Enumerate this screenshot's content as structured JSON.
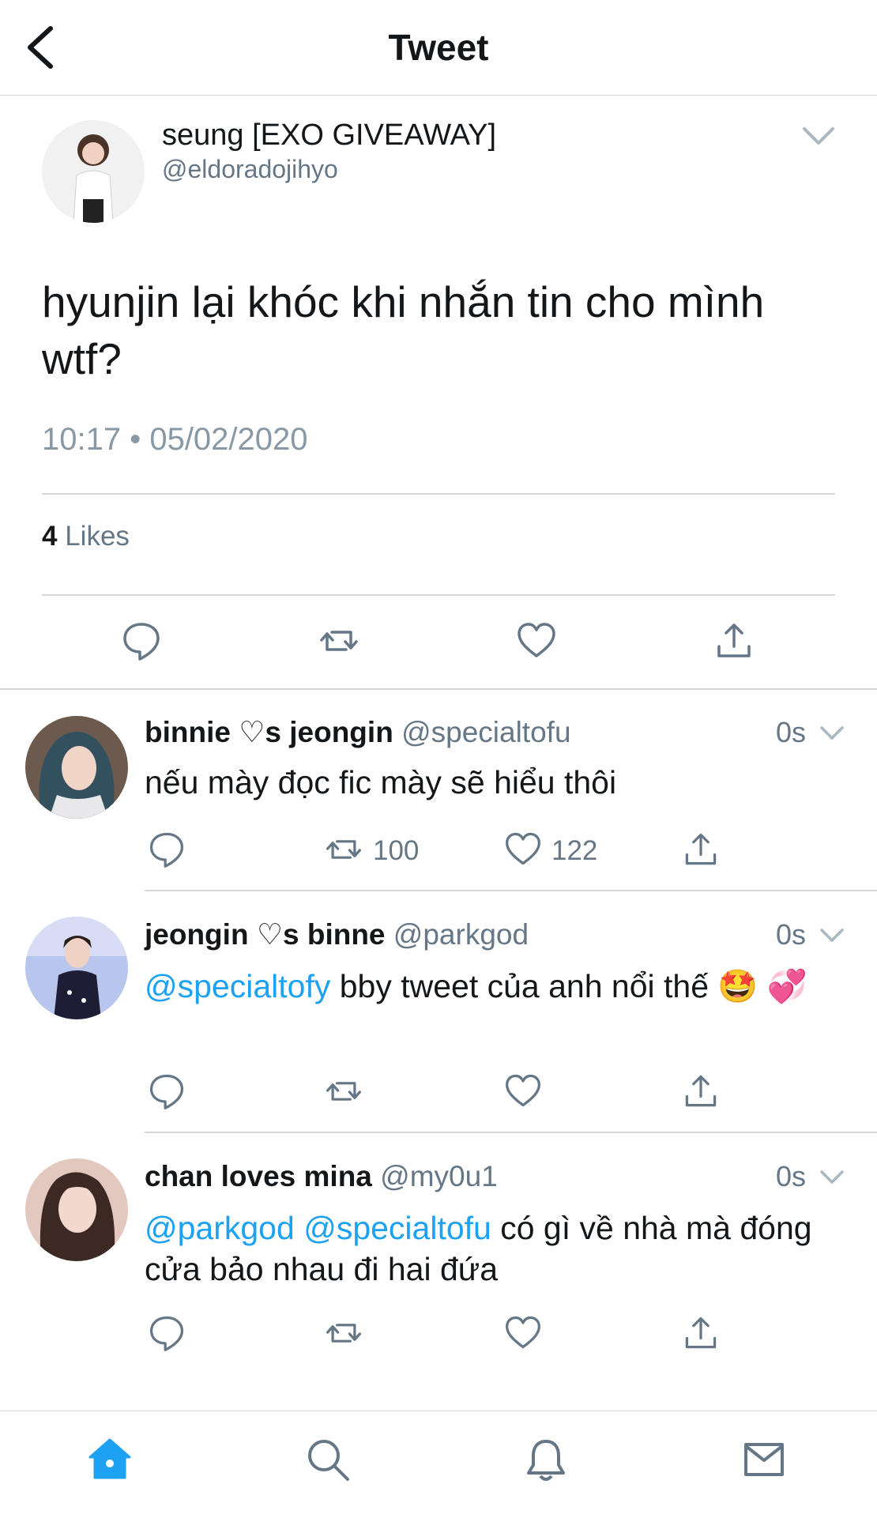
{
  "header": {
    "title": "Tweet",
    "back_icon": "back-arrow-icon"
  },
  "main_tweet": {
    "display_name": "seung [EXO GIVEAWAY]",
    "handle": "@eldoradojihyo",
    "text": "hyunjin lại khóc khi nhắn tin cho mình wtf?",
    "timestamp": "10:17 • 05/02/2020",
    "likes_count": "4",
    "likes_label": "Likes"
  },
  "replies": [
    {
      "display_name": "binnie ♡s jeongin",
      "handle": "@specialtofu",
      "time": "0s",
      "text": "nếu mày đọc fic mày sẽ hiểu thôi",
      "retweets": "100",
      "likes": "122"
    },
    {
      "display_name": "jeongin ♡s binne",
      "handle": "@parkgod",
      "time": "0s",
      "mention": "@specialtofy",
      "text": " bby tweet của anh nổi thế 🤩 💞",
      "retweets": "",
      "likes": ""
    },
    {
      "display_name": "chan loves mina",
      "handle": "@my0u1",
      "time": "0s",
      "mention1": "@parkgod",
      "mention2": "@specialtofu",
      "text": " có gì về nhà mà đóng cửa bảo nhau đi hai đứa",
      "retweets": "",
      "likes": ""
    }
  ],
  "tabbar": {
    "items": [
      "home-icon",
      "search-icon",
      "notifications-bell-icon",
      "messages-envelope-icon"
    ],
    "active_color": "#1da1f2"
  },
  "colors": {
    "accent": "#1da1f2",
    "muted": "#657786",
    "icon": "#657786"
  }
}
